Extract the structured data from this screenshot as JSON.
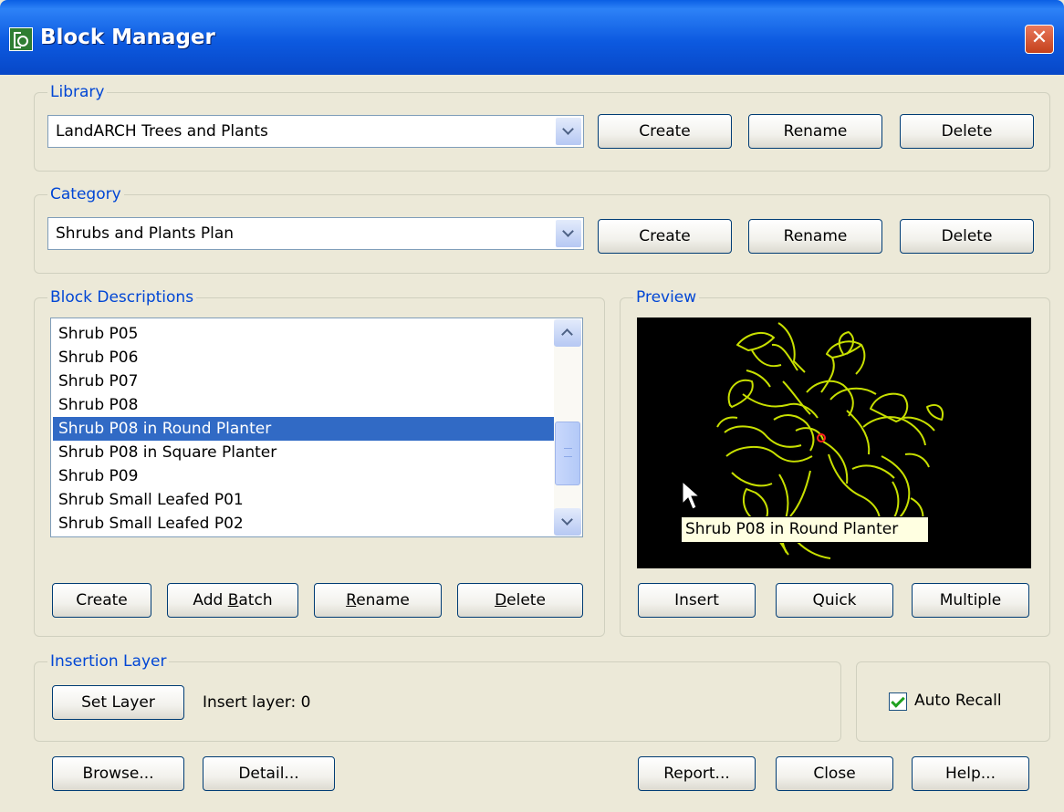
{
  "window": {
    "title": "Block Manager",
    "close_glyph": "✕"
  },
  "library": {
    "label": "Library",
    "selected": "LandARCH Trees and Plants",
    "buttons": {
      "create": "Create",
      "rename": "Rename",
      "delete": "Delete"
    }
  },
  "category": {
    "label": "Category",
    "selected": "Shrubs and Plants Plan",
    "buttons": {
      "create": "Create",
      "rename": "Rename",
      "delete": "Delete"
    }
  },
  "block_descriptions": {
    "label": "Block Descriptions",
    "items": [
      "Shrub P05",
      "Shrub P06",
      "Shrub P07",
      "Shrub P08",
      "Shrub P08 in Round Planter",
      "Shrub P08 in Square Planter",
      "Shrub P09",
      "Shrub Small Leafed P01",
      "Shrub Small Leafed P02"
    ],
    "selected_index": 4,
    "buttons": {
      "create": "Create",
      "add_batch_pre": "Add ",
      "add_batch_ul": "B",
      "add_batch_post": "atch",
      "rename_ul": "R",
      "rename_post": "ename",
      "delete_ul": "D",
      "delete_post": "elete"
    }
  },
  "preview": {
    "label": "Preview",
    "tooltip": "Shrub P08 in Round Planter",
    "buttons": {
      "insert": "Insert",
      "quick": "Quick",
      "multiple": "Multiple"
    },
    "colors": {
      "background": "#000000",
      "drawing": "#C8E000",
      "center": "#FF2020"
    }
  },
  "insertion_layer": {
    "label": "Insertion Layer",
    "set_layer": "Set Layer",
    "insert_layer_text": "Insert layer: 0"
  },
  "auto_recall": {
    "label": "Auto Recall",
    "checked": true
  },
  "footer": {
    "browse": "Browse...",
    "detail": "Detail...",
    "report": "Report...",
    "close": "Close",
    "help": "Help..."
  }
}
